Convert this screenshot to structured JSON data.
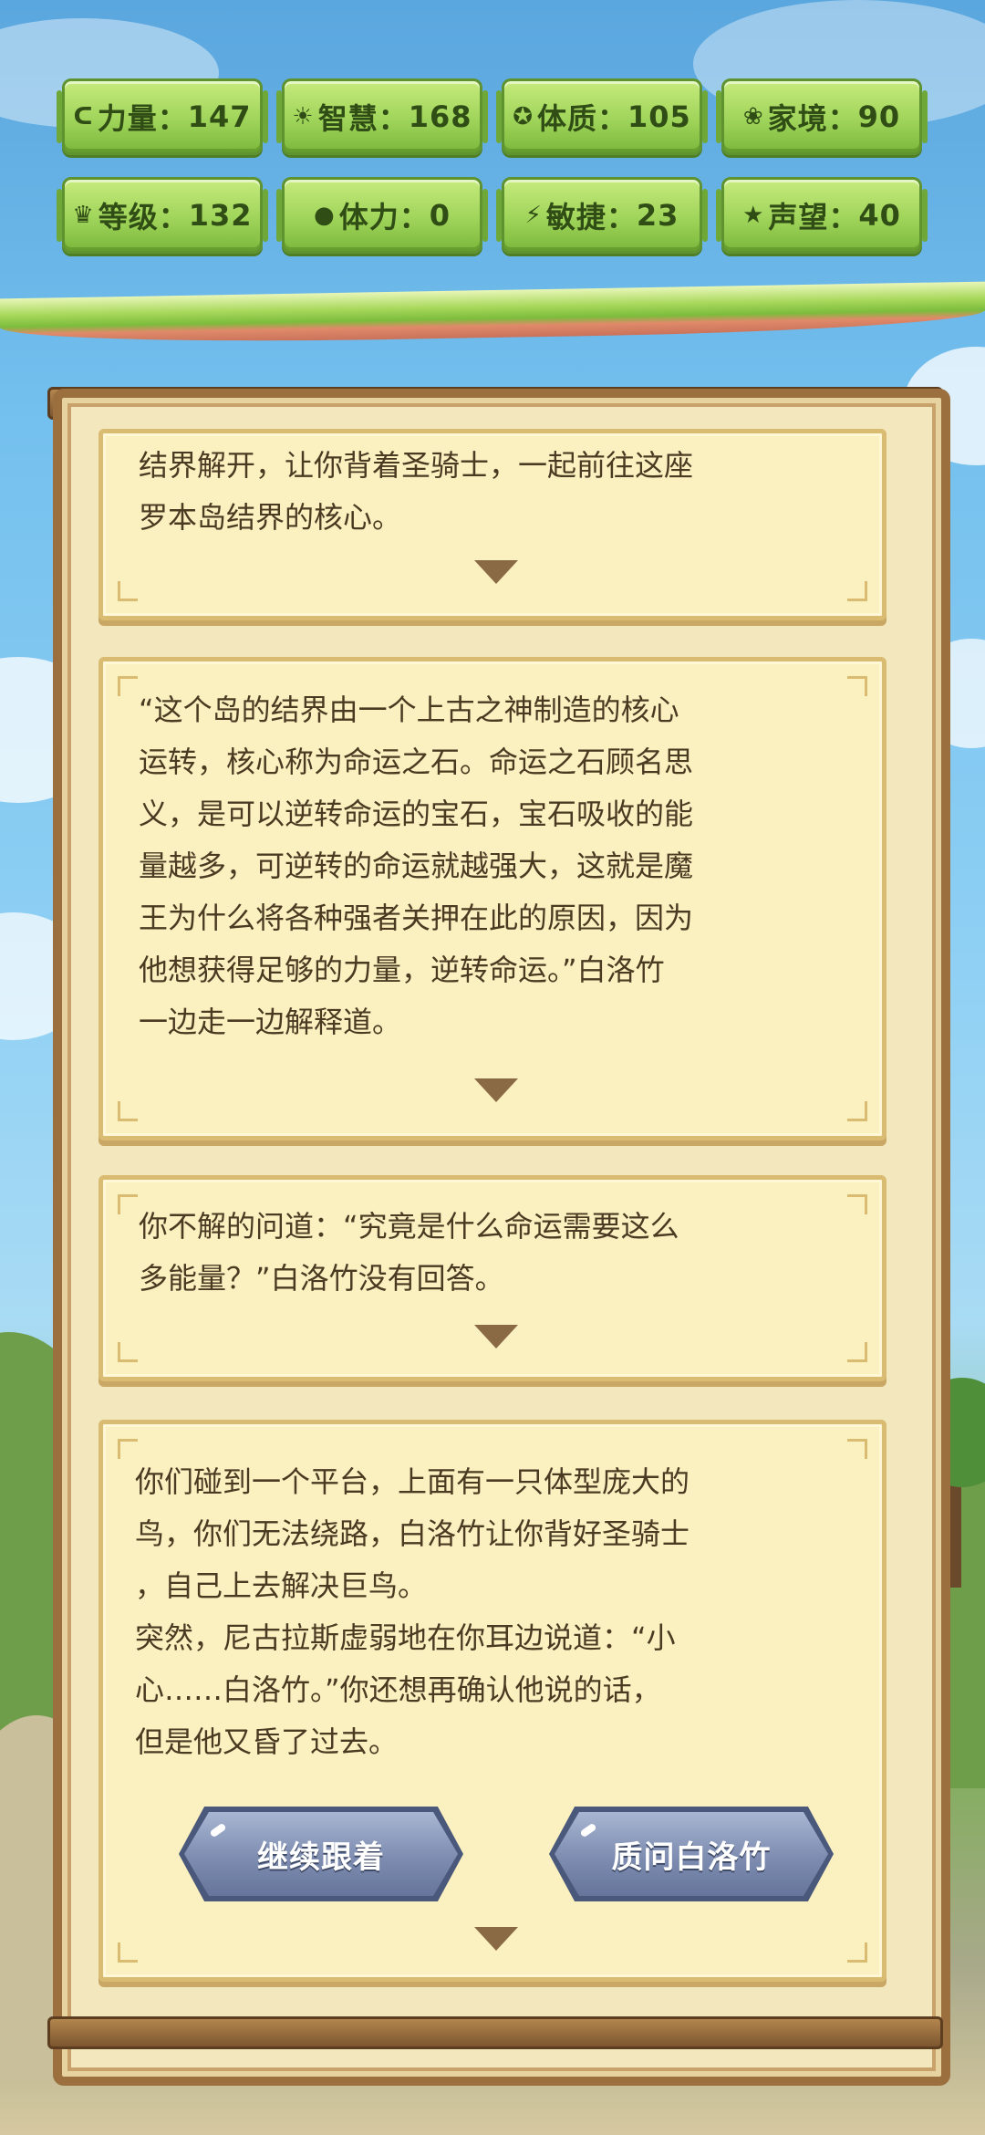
{
  "stats": [
    {
      "icon": "strength-icon",
      "glyph": "ᑕ",
      "label": "力量",
      "value": "147"
    },
    {
      "icon": "wisdom-icon",
      "glyph": "☀",
      "label": "智慧",
      "value": "168"
    },
    {
      "icon": "constitution-icon",
      "glyph": "✪",
      "label": "体质",
      "value": "105"
    },
    {
      "icon": "family-icon",
      "glyph": "❀",
      "label": "家境",
      "value": " 90"
    },
    {
      "icon": "crown-icon",
      "glyph": "♛",
      "label": "等级",
      "value": "132"
    },
    {
      "icon": "stamina-icon",
      "glyph": "●",
      "label": "体力",
      "value": " 0"
    },
    {
      "icon": "agility-icon",
      "glyph": "⚡",
      "label": "敏捷",
      "value": " 23"
    },
    {
      "icon": "star-icon",
      "glyph": "★",
      "label": "声望",
      "value": " 40"
    }
  ],
  "dialogs": [
    {
      "text": "结界解开，让你背着圣骑士，一起前往这座\n罗本岛结界的核心。"
    },
    {
      "text": "“这个岛的结界由一个上古之神制造的核心\n运转，核心称为命运之石。命运之石顾名思\n义，是可以逆转命运的宝石，宝石吸收的能\n量越多，可逆转的命运就越强大，这就是魔\n王为什么将各种强者关押在此的原因，因为\n他想获得足够的力量，逆转命运。”白洛竹\n一边走一边解释道。"
    },
    {
      "text": "你不解的问道：“究竟是什么命运需要这么\n多能量？”白洛竹没有回答。"
    },
    {
      "text": "你们碰到一个平台，上面有一只体型庞大的\n鸟，你们无法绕路，白洛竹让你背好圣骑士\n，自己上去解决巨鸟。\n突然，尼古拉斯虚弱地在你耳边说道：“小\n心……白洛竹。”你还想再确认他说的话，\n但是他又昏了过去。"
    }
  ],
  "choices": {
    "follow": "继续跟着",
    "question": "质问白洛竹"
  },
  "colors": {
    "stat_plate": "#9fd45a",
    "dialog_bg": "#fbf0c0",
    "frame": "#9b6f3e",
    "choice_btn": "#7d8cb0"
  }
}
